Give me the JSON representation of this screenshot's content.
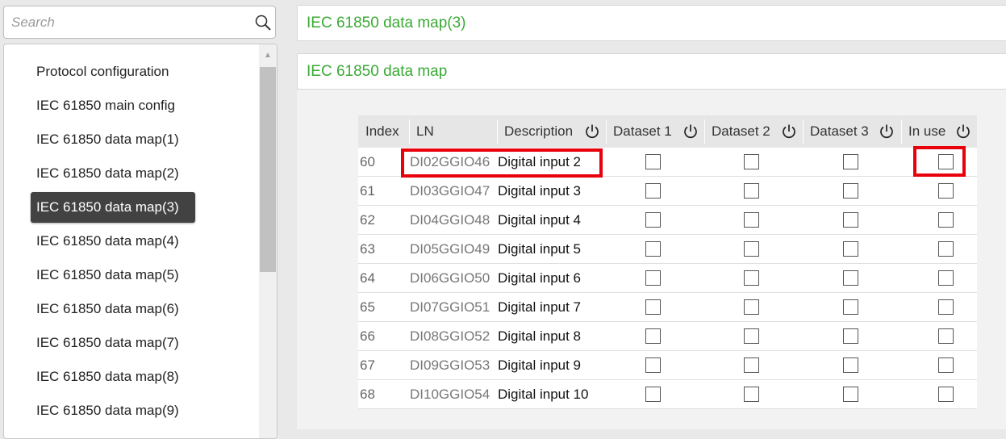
{
  "search": {
    "placeholder": "Search",
    "icon": "search-icon"
  },
  "sidebar": {
    "items": [
      {
        "label": "Protocol configuration",
        "active": false
      },
      {
        "label": "IEC 61850 main config",
        "active": false
      },
      {
        "label": "IEC 61850 data map(1)",
        "active": false
      },
      {
        "label": "IEC 61850 data map(2)",
        "active": false
      },
      {
        "label": "IEC 61850 data map(3)",
        "active": true
      },
      {
        "label": "IEC 61850 data map(4)",
        "active": false
      },
      {
        "label": "IEC 61850 data map(5)",
        "active": false
      },
      {
        "label": "IEC 61850 data map(6)",
        "active": false
      },
      {
        "label": "IEC 61850 data map(7)",
        "active": false
      },
      {
        "label": "IEC 61850 data map(8)",
        "active": false
      },
      {
        "label": "IEC 61850 data map(9)",
        "active": false
      }
    ]
  },
  "main": {
    "page_title": "IEC 61850 data map(3)",
    "section_title": "IEC 61850 data map"
  },
  "table": {
    "columns": [
      "Index",
      "LN",
      "Description",
      "Dataset 1",
      "Dataset 2",
      "Dataset 3",
      "In use"
    ],
    "reset_icon": "power-reset-icon",
    "rows": [
      {
        "index": "60",
        "ln": "DI02GGIO46",
        "description": "Digital input 2",
        "dataset1": false,
        "dataset2": false,
        "dataset3": false,
        "in_use": false
      },
      {
        "index": "61",
        "ln": "DI03GGIO47",
        "description": "Digital input 3",
        "dataset1": false,
        "dataset2": false,
        "dataset3": false,
        "in_use": false
      },
      {
        "index": "62",
        "ln": "DI04GGIO48",
        "description": "Digital input 4",
        "dataset1": false,
        "dataset2": false,
        "dataset3": false,
        "in_use": false
      },
      {
        "index": "63",
        "ln": "DI05GGIO49",
        "description": "Digital input 5",
        "dataset1": false,
        "dataset2": false,
        "dataset3": false,
        "in_use": false
      },
      {
        "index": "64",
        "ln": "DI06GGIO50",
        "description": "Digital input 6",
        "dataset1": false,
        "dataset2": false,
        "dataset3": false,
        "in_use": false
      },
      {
        "index": "65",
        "ln": "DI07GGIO51",
        "description": "Digital input 7",
        "dataset1": false,
        "dataset2": false,
        "dataset3": false,
        "in_use": false
      },
      {
        "index": "66",
        "ln": "DI08GGIO52",
        "description": "Digital input 8",
        "dataset1": false,
        "dataset2": false,
        "dataset3": false,
        "in_use": false
      },
      {
        "index": "67",
        "ln": "DI09GGIO53",
        "description": "Digital input 9",
        "dataset1": false,
        "dataset2": false,
        "dataset3": false,
        "in_use": false
      },
      {
        "index": "68",
        "ln": "DI10GGIO54",
        "description": "Digital input 10",
        "dataset1": false,
        "dataset2": false,
        "dataset3": false,
        "in_use": false
      }
    ]
  },
  "colors": {
    "accent_green": "#3aaa35",
    "active_nav_bg": "#424242",
    "highlight_red": "#e8000b"
  }
}
